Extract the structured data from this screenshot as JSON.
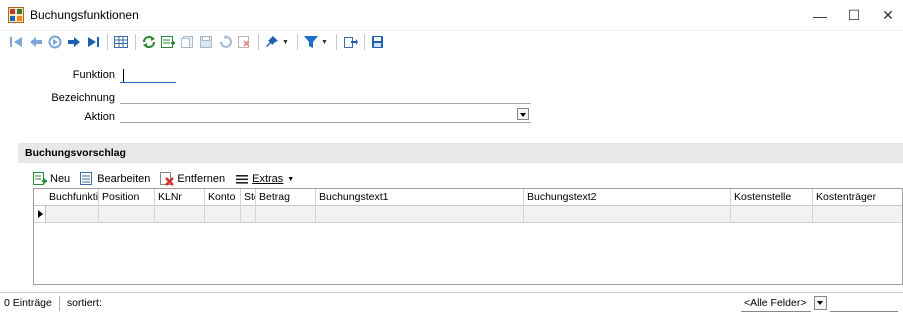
{
  "window": {
    "title": "Buchungsfunktionen",
    "controls": {
      "minimize": "—",
      "maximize": "☐",
      "close": "✕"
    }
  },
  "toolbar": {
    "icons": [
      "first-record-icon",
      "previous-record-icon",
      "go-icon",
      "next-record-icon",
      "last-record-icon",
      "table-view-icon",
      "refresh-icon",
      "new-record-icon",
      "copy-record-icon",
      "save-icon",
      "undo-icon",
      "delete-icon",
      "pin-icon",
      "filter-icon",
      "export-icon",
      "print-icon"
    ]
  },
  "form": {
    "funktion_label": "Funktion",
    "funktion_value": "",
    "bezeichnung_label": "Bezeichnung",
    "bezeichnung_value": "",
    "aktion_label": "Aktion",
    "aktion_value": ""
  },
  "group": {
    "title": "Buchungsvorschlag"
  },
  "grid_toolbar": {
    "new_label": "Neu",
    "edit_label": "Bearbeiten",
    "remove_label": "Entfernen",
    "extras_label": "Extras"
  },
  "grid": {
    "columns": [
      "Buchfunktion",
      "Position",
      "KLNr",
      "Konto",
      "Steuer",
      "Betrag",
      "Buchungstext1",
      "Buchungstext2",
      "Kostenstelle",
      "Kostenträger"
    ]
  },
  "status": {
    "count": "0 Einträge",
    "sorted": "sortiert:",
    "filter_value": "<Alle Felder>"
  },
  "colors": {
    "accent_blue": "#2a63c9",
    "group_header_bg": "#e8e8e8",
    "row_bg": "#f2f2f2"
  }
}
